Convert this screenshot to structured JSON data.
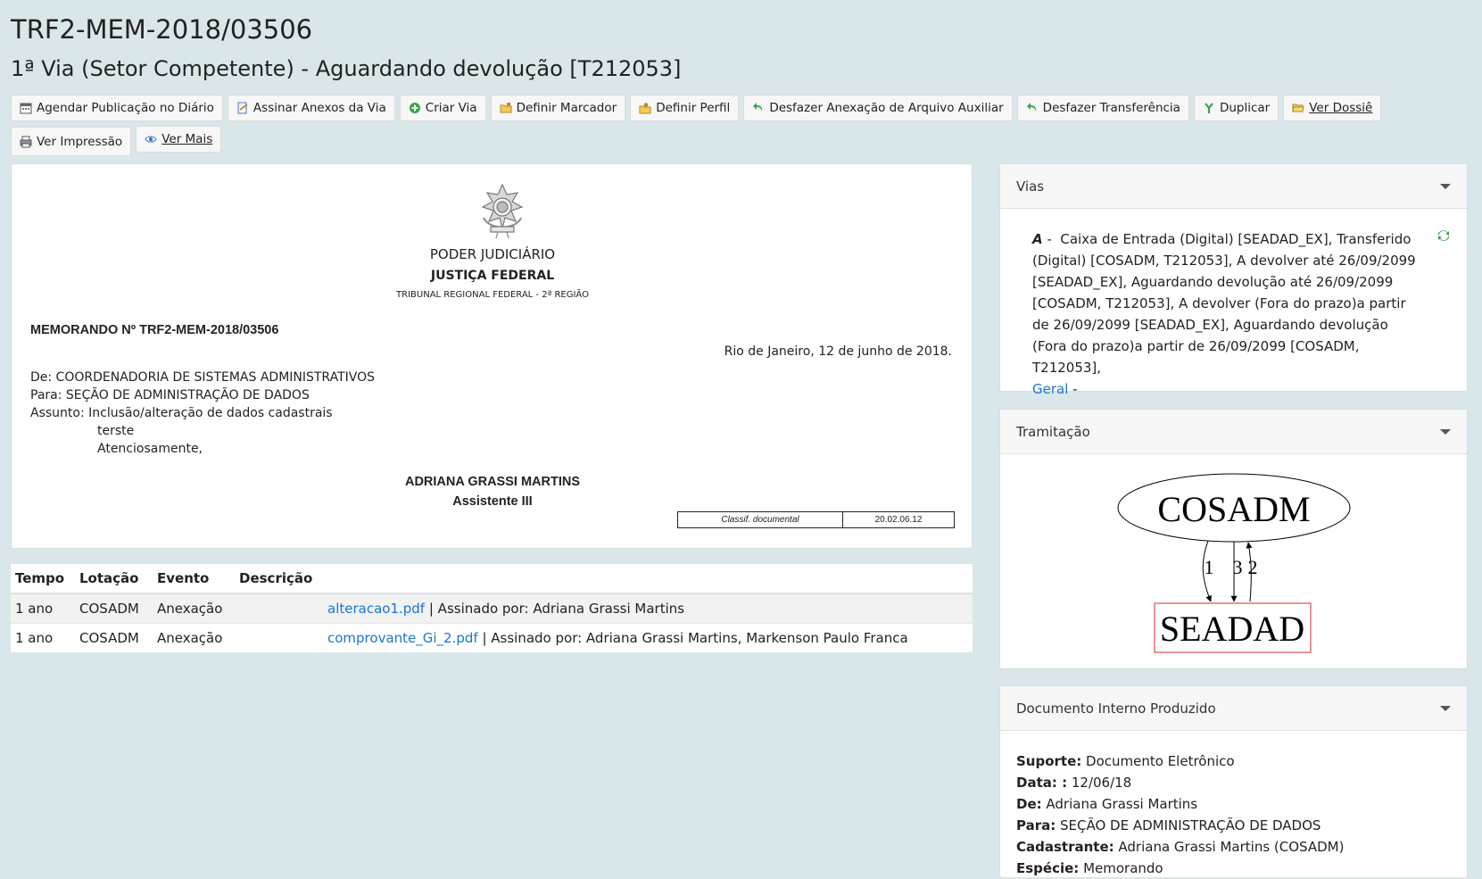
{
  "header": {
    "title": "TRF2-MEM-2018/03506",
    "subtitle": "1ª Via (Setor Competente) - Aguardando devolução [T212053]"
  },
  "toolbar": {
    "agendar": "Agendar Publicação no Diário",
    "assinar": "Assinar Anexos da Via",
    "criar_via": "Criar Via",
    "definir_marcador": "Definir Marcador",
    "definir_perfil": "Definir Perfil",
    "desfazer_anexacao": "Desfazer Anexação de Arquivo Auxiliar",
    "desfazer_transferencia": "Desfazer Transferência",
    "duplicar": "Duplicar",
    "ver_dossie": "Ver Dossiê",
    "ver_impressao": "Ver Impressão",
    "ver_mais": "Ver Mais"
  },
  "document": {
    "poder": "PODER JUDICIÁRIO",
    "justica": "JUSTIÇA FEDERAL",
    "tribunal": "TRIBUNAL REGIONAL FEDERAL - 2ª REGIÃO",
    "memo": "MEMORANDO Nº TRF2-MEM-2018/03506",
    "date_place": "Rio de Janeiro, 12 de junho de 2018.",
    "de": "De: COORDENADORIA DE SISTEMAS ADMINISTRATIVOS",
    "para": "Para: SEÇÃO DE ADMINISTRAÇÃO DE DADOS",
    "assunto": "Assunto: Inclusão/alteração de dados cadastrais",
    "body1": "terste",
    "body2": "Atenciosamente,",
    "signer_name": "ADRIANA GRASSI MARTINS",
    "signer_role": "Assistente III",
    "classif_label": "Classif. documental",
    "classif_value": "20.02.06.12"
  },
  "movements": {
    "headers": [
      "Tempo",
      "Lotação",
      "Evento",
      "Descrição"
    ],
    "rows": [
      {
        "tempo": "1 ano",
        "lotacao": "COSADM",
        "evento": "Anexação",
        "file": "alteracao1.pdf",
        "signed": " | Assinado por: Adriana Grassi Martins"
      },
      {
        "tempo": "1 ano",
        "lotacao": "COSADM",
        "evento": "Anexação",
        "file": "comprovante_Gi_2.pdf",
        "signed": " | Assinado por: Adriana Grassi Martins, Markenson Paulo Franca"
      }
    ]
  },
  "vias": {
    "title": "Vias",
    "letter": "A",
    "sep": " - ",
    "text": "Caixa de Entrada (Digital) [SEADAD_EX], Transferido (Digital) [COSADM, T212053], A devolver até 26/09/2099 [SEADAD_EX], Aguardando devolução até 26/09/2099 [COSADM, T212053], A devolver (Fora do prazo)a partir de 26/09/2099 [SEADAD_EX], Aguardando devolução (Fora do prazo)a partir de 26/09/2099 [COSADM, T212053],",
    "geral": "Geral",
    "geral_sep": " -"
  },
  "tramitacao": {
    "title": "Tramitação",
    "node_top": "COSADM",
    "node_bottom": "SEADAD",
    "edge1": "1",
    "edge2": "3",
    "edge3": "2"
  },
  "doc_interno": {
    "title": "Documento Interno Produzido",
    "suporte_label": "Suporte:",
    "suporte": " Documento Eletrônico",
    "data_label": "Data: :",
    "data": " 12/06/18",
    "de_label": "De:",
    "de": " Adriana Grassi Martins",
    "para_label": "Para:",
    "para": " SEÇÃO DE ADMINISTRAÇÃO DE DADOS",
    "cadastrante_label": "Cadastrante:",
    "cadastrante": " Adriana Grassi Martins (COSADM)",
    "especie_label": "Espécie:",
    "especie": " Memorando"
  },
  "colors": {
    "background": "#d9e7ea",
    "link": "#1a75d2",
    "seadad_border": "#e06666"
  }
}
